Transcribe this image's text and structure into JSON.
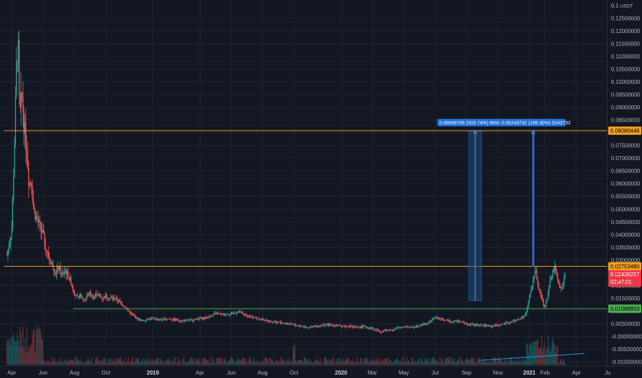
{
  "chart_data": {
    "type": "candlestick",
    "currency": "USDT",
    "y_ticks": [
      "0.12500000",
      "0.12000000",
      "0.11500000",
      "0.11000000",
      "0.10500000",
      "0.10000000",
      "0.09500000",
      "0.09000000",
      "0.08500000",
      "0.08000000",
      "0.07500000",
      "0.07000000",
      "0.06500000",
      "0.06000000",
      "0.05500000",
      "0.05000000",
      "0.04500000",
      "0.04000000",
      "0.03500000",
      "0.03000000",
      "0.02500000",
      "0.02000000",
      "0.01500000",
      "0.01000000",
      "0.00500000",
      "-0.00000000",
      "-0.00500000",
      "-0.01000000"
    ],
    "y_top_label": "0.1",
    "ylim": [
      -0.0115,
      0.1305
    ],
    "x_ticks": [
      {
        "label": "Apr",
        "t": 0,
        "bold": false
      },
      {
        "label": "Jun",
        "t": 2,
        "bold": false
      },
      {
        "label": "Aug",
        "t": 4,
        "bold": false
      },
      {
        "label": "Oct",
        "t": 6,
        "bold": false
      },
      {
        "label": "2019",
        "t": 9,
        "bold": true
      },
      {
        "label": "Apr",
        "t": 12,
        "bold": false
      },
      {
        "label": "Jun",
        "t": 14,
        "bold": false
      },
      {
        "label": "Aug",
        "t": 16,
        "bold": false
      },
      {
        "label": "Oct",
        "t": 18,
        "bold": false
      },
      {
        "label": "2020",
        "t": 21,
        "bold": true
      },
      {
        "label": "Mar",
        "t": 23,
        "bold": false
      },
      {
        "label": "May",
        "t": 25,
        "bold": false
      },
      {
        "label": "Jul",
        "t": 27,
        "bold": false
      },
      {
        "label": "Sep",
        "t": 29,
        "bold": false
      },
      {
        "label": "Nov",
        "t": 31,
        "bold": false
      },
      {
        "label": "2021",
        "t": 33,
        "bold": true
      },
      {
        "label": "Feb",
        "t": 34,
        "bold": false
      },
      {
        "label": "Apr",
        "t": 36,
        "bold": false
      },
      {
        "label": "Ju",
        "t": 38,
        "bold": false
      }
    ],
    "price_path": [
      [
        -0.3,
        0.032
      ],
      [
        0,
        0.042
      ],
      [
        0.15,
        0.07
      ],
      [
        0.3,
        0.105
      ],
      [
        0.4,
        0.118
      ],
      [
        0.5,
        0.085
      ],
      [
        0.65,
        0.095
      ],
      [
        0.8,
        0.082
      ],
      [
        0.95,
        0.075
      ],
      [
        1.1,
        0.06
      ],
      [
        1.25,
        0.062
      ],
      [
        1.4,
        0.05
      ],
      [
        1.6,
        0.046
      ],
      [
        1.8,
        0.043
      ],
      [
        2.0,
        0.04
      ],
      [
        2.2,
        0.034
      ],
      [
        2.4,
        0.03
      ],
      [
        2.6,
        0.028
      ],
      [
        2.8,
        0.025
      ],
      [
        3.0,
        0.027
      ],
      [
        3.2,
        0.024
      ],
      [
        3.4,
        0.026
      ],
      [
        3.6,
        0.024
      ],
      [
        3.8,
        0.021
      ],
      [
        4.0,
        0.017
      ],
      [
        4.2,
        0.015
      ],
      [
        4.4,
        0.016
      ],
      [
        4.6,
        0.014
      ],
      [
        4.8,
        0.016
      ],
      [
        5.0,
        0.017
      ],
      [
        5.2,
        0.015
      ],
      [
        5.4,
        0.017
      ],
      [
        5.6,
        0.016
      ],
      [
        5.8,
        0.015
      ],
      [
        6.0,
        0.016
      ],
      [
        6.2,
        0.015
      ],
      [
        6.5,
        0.015
      ],
      [
        6.8,
        0.014
      ],
      [
        7.0,
        0.013
      ],
      [
        7.3,
        0.011
      ],
      [
        7.6,
        0.009
      ],
      [
        8.0,
        0.007
      ],
      [
        8.3,
        0.006
      ],
      [
        8.7,
        0.007
      ],
      [
        9.0,
        0.007
      ],
      [
        9.5,
        0.0065
      ],
      [
        10.0,
        0.007
      ],
      [
        10.5,
        0.0065
      ],
      [
        11.0,
        0.006
      ],
      [
        11.5,
        0.0065
      ],
      [
        12.0,
        0.007
      ],
      [
        12.5,
        0.0075
      ],
      [
        13.0,
        0.009
      ],
      [
        13.5,
        0.0085
      ],
      [
        14.0,
        0.009
      ],
      [
        14.5,
        0.0095
      ],
      [
        15.0,
        0.008
      ],
      [
        15.5,
        0.0075
      ],
      [
        16.0,
        0.0065
      ],
      [
        16.5,
        0.006
      ],
      [
        17.0,
        0.0055
      ],
      [
        17.5,
        0.005
      ],
      [
        18.0,
        0.0045
      ],
      [
        18.5,
        0.004
      ],
      [
        19.0,
        0.0035
      ],
      [
        19.5,
        0.004
      ],
      [
        20.0,
        0.0045
      ],
      [
        20.5,
        0.0045
      ],
      [
        21.0,
        0.004
      ],
      [
        21.5,
        0.004
      ],
      [
        22.0,
        0.0035
      ],
      [
        22.5,
        0.004
      ],
      [
        23.0,
        0.003
      ],
      [
        23.5,
        0.002
      ],
      [
        24.0,
        0.0025
      ],
      [
        24.5,
        0.003
      ],
      [
        25.0,
        0.004
      ],
      [
        25.5,
        0.0035
      ],
      [
        26.0,
        0.0045
      ],
      [
        26.5,
        0.005
      ],
      [
        27.0,
        0.0075
      ],
      [
        27.5,
        0.0065
      ],
      [
        28.0,
        0.006
      ],
      [
        28.5,
        0.006
      ],
      [
        29.0,
        0.005
      ],
      [
        29.5,
        0.0045
      ],
      [
        30.0,
        0.0045
      ],
      [
        30.5,
        0.004
      ],
      [
        31.0,
        0.0045
      ],
      [
        31.5,
        0.005
      ],
      [
        32.0,
        0.006
      ],
      [
        32.5,
        0.007
      ],
      [
        32.8,
        0.009
      ],
      [
        33.0,
        0.015
      ],
      [
        33.2,
        0.021
      ],
      [
        33.4,
        0.026
      ],
      [
        33.6,
        0.019
      ],
      [
        33.8,
        0.015
      ],
      [
        34.0,
        0.011
      ],
      [
        34.2,
        0.017
      ],
      [
        34.4,
        0.024
      ],
      [
        34.6,
        0.0268
      ],
      [
        34.8,
        0.023
      ],
      [
        35.0,
        0.018
      ],
      [
        35.2,
        0.022
      ],
      [
        35.3,
        0.024
      ]
    ],
    "h_lines": [
      {
        "value": 0.08080446,
        "color": "#f7a21b",
        "label": "0.08080446",
        "badge_color": "#f7a21b",
        "badge_text_color": "#000000"
      },
      {
        "value": 0.0275348,
        "color": "#f7a21b",
        "label": "0.02753480",
        "badge_color": "#f7a21b",
        "badge_text_color": "#000000"
      },
      {
        "value": 0.01088803,
        "color": "#4caf50",
        "label": "0.01088803",
        "badge_color": "#4caf50",
        "badge_text_color": "#000000"
      }
    ],
    "h_line_start_t": [
      -0.5,
      -0.5,
      3.9
    ],
    "current_price": {
      "value": 0.02436257,
      "label": "0.02436257",
      "countdown": "02:47:01",
      "color": "#f23645"
    },
    "measures": [
      {
        "t_start": 29.15,
        "t_end": 29.95,
        "y_start": 0.014,
        "y_end": 0.0806,
        "text": "0.06658706 (503.74%) 6658706"
      },
      {
        "t_start": 33.2,
        "t_end": 33.3,
        "y_start": 0.0275,
        "y_end": 0.0806,
        "text": "0.05243732 (189.30%) 5243732"
      }
    ],
    "volume_trend": {
      "t_start": 29.8,
      "t_end": 36.5,
      "y_start": -0.0094,
      "y_end": -0.0067,
      "color": "#2196f3"
    },
    "colors": {
      "background": "#131722",
      "grid": "#1f2433",
      "up": "#26a69a",
      "down": "#ef5350",
      "measure_fill": "#1e4d78",
      "measure_stroke": "#2962ff",
      "measure_label": "#1e6ed8"
    }
  }
}
